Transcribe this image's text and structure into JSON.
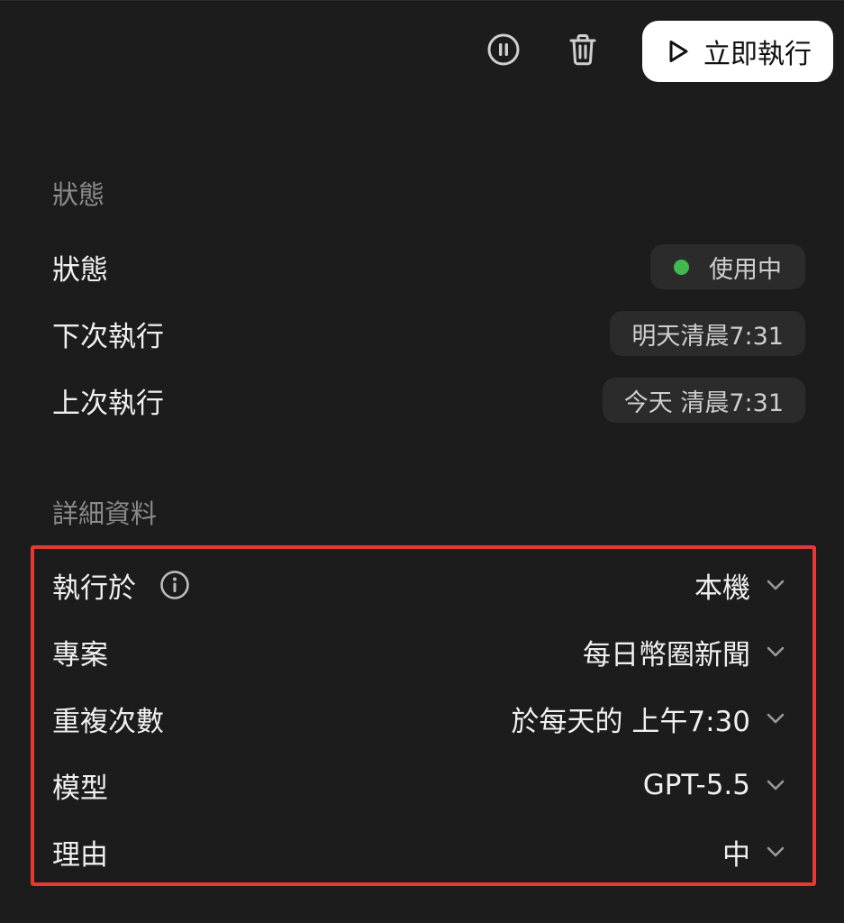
{
  "toolbar": {
    "pause_icon": "pause-circle-icon",
    "delete_icon": "trash-icon",
    "run_label": "立即執行",
    "run_icon": "play-icon"
  },
  "status_section": {
    "title": "狀態",
    "rows": [
      {
        "label": "狀態",
        "value": "使用中",
        "dot_color": "#3fb950"
      },
      {
        "label": "下次執行",
        "value": "明天清晨7:31"
      },
      {
        "label": "上次執行",
        "value": "今天 清晨7:31"
      }
    ]
  },
  "details_section": {
    "title": "詳細資料",
    "rows": [
      {
        "label": "執行於",
        "value": "本機",
        "info_icon": "info-icon"
      },
      {
        "label": "專案",
        "value": "每日幣圈新聞"
      },
      {
        "label": "重複次數",
        "value": "於每天的 上午7:30"
      },
      {
        "label": "模型",
        "value": "GPT-5.5"
      },
      {
        "label": "理由",
        "value": "中"
      }
    ]
  },
  "colors": {
    "background": "#1c1c1c",
    "pill": "#2b2b2b",
    "highlight_border": "#e53935",
    "active_dot": "#3fb950"
  }
}
